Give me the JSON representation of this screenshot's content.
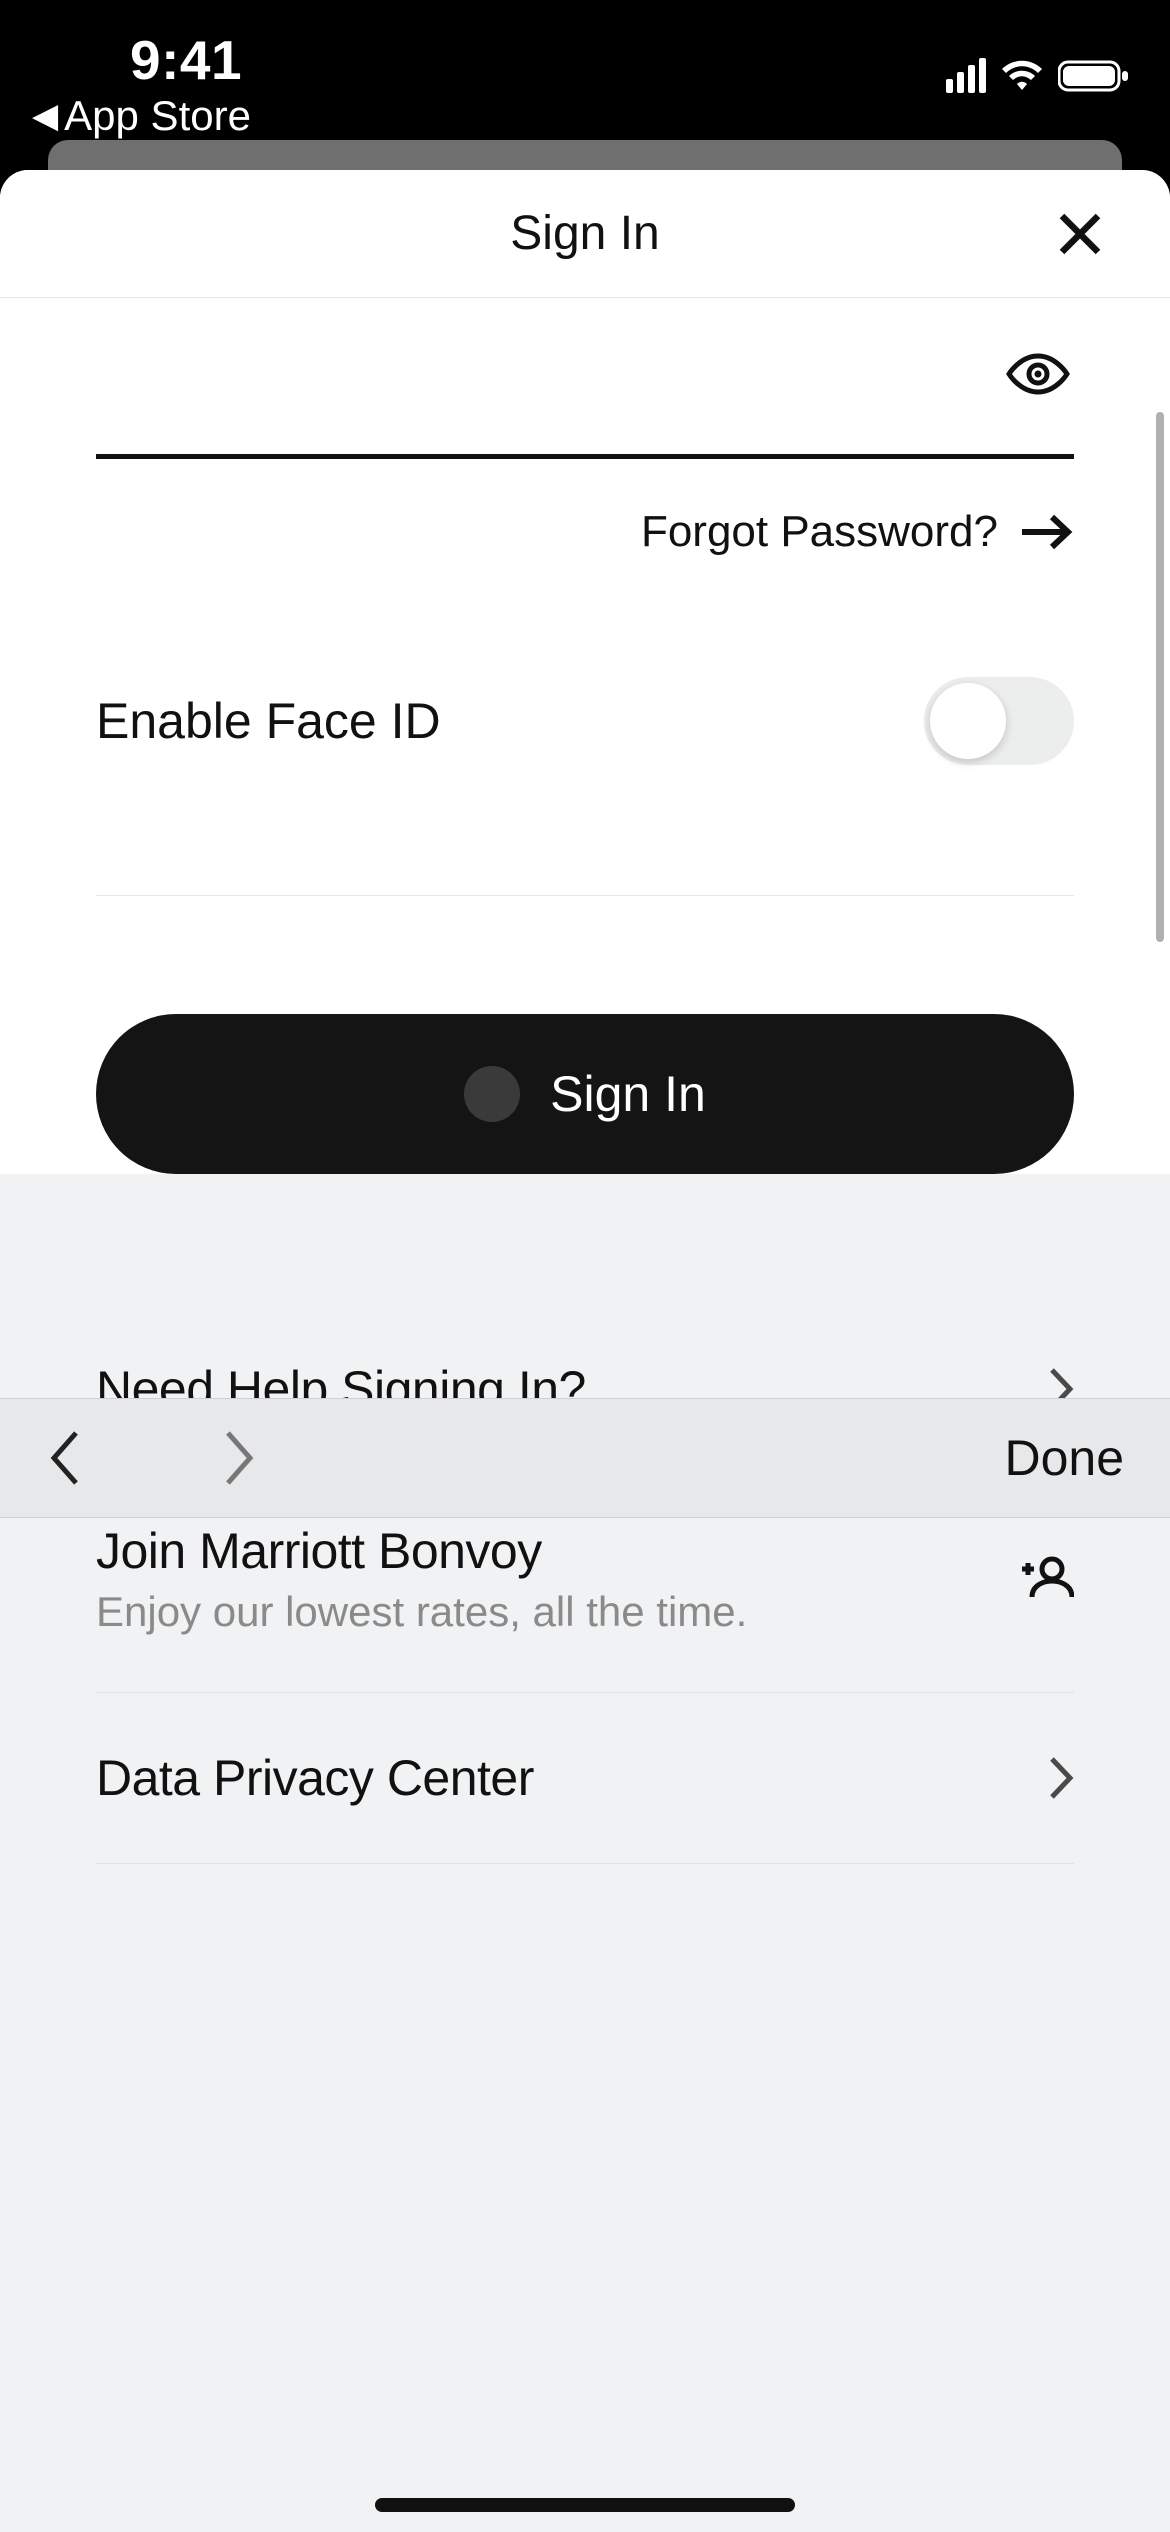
{
  "statusbar": {
    "time": "9:41",
    "back_label": "App Store"
  },
  "sheet": {
    "title": "Sign In"
  },
  "form": {
    "password_value": "",
    "forgot_password": "Forgot Password?",
    "face_id_label": "Enable Face ID",
    "face_id_on": false,
    "submit_label": "Sign In"
  },
  "kbbar": {
    "done": "Done"
  },
  "rows": {
    "help": {
      "title": "Need Help Signing In?"
    },
    "join": {
      "title": "Join Marriott Bonvoy",
      "sub": "Enjoy our lowest rates, all the time."
    },
    "privacy": {
      "title": "Data Privacy Center"
    }
  }
}
